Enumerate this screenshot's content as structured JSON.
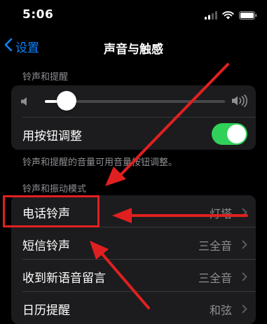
{
  "status_bar": {
    "time": "5:06",
    "icons": [
      "cellular-icon",
      "wifi-icon",
      "battery-icon"
    ]
  },
  "nav": {
    "back_label": "设置",
    "title": "声音与触感"
  },
  "ringer_section": {
    "header": "铃声和提醒",
    "volume_level": 0.12,
    "change_with_buttons_label": "用按钮调整",
    "change_with_buttons_on": true,
    "footnote": "铃声和提醒的音量可用音量按钮调整。"
  },
  "patterns_section": {
    "header": "铃声和振动模式",
    "rows": [
      {
        "label": "电话铃声",
        "value": "灯塔"
      },
      {
        "label": "短信铃声",
        "value": "三全音"
      },
      {
        "label": "收到新语音留言",
        "value": "三全音"
      },
      {
        "label": "日历提醒",
        "value": "和弦"
      }
    ]
  },
  "colors": {
    "accent": "#0a84ff",
    "toggle_on": "#30d158",
    "annotation": "#e02020",
    "cell_bg": "#1c1c1e"
  }
}
